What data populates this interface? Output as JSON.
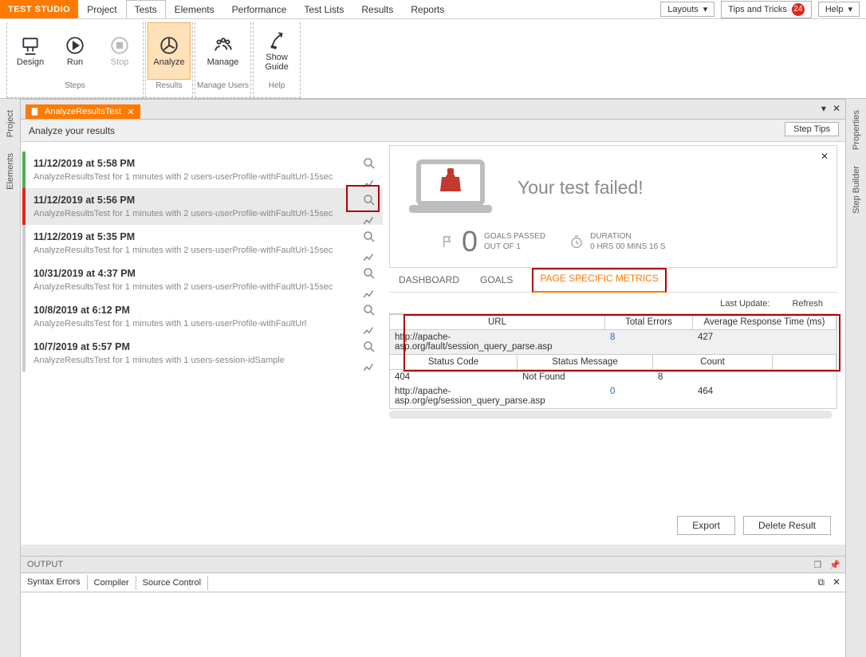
{
  "brand": "TEST STUDIO",
  "menu": [
    "Project",
    "Tests",
    "Elements",
    "Performance",
    "Test Lists",
    "Results",
    "Reports"
  ],
  "menu_active": 1,
  "top_right": {
    "layouts": "Layouts",
    "tips": "Tips and Tricks",
    "tips_badge": "24",
    "help": "Help"
  },
  "ribbon": {
    "steps": {
      "label": "Steps",
      "items": [
        {
          "t": "Design"
        },
        {
          "t": "Run"
        },
        {
          "t": "Stop",
          "disabled": true
        }
      ]
    },
    "results": {
      "label": "Results",
      "items": [
        {
          "t": "Analyze",
          "active": true
        }
      ]
    },
    "users": {
      "label": "Manage Users",
      "items": [
        {
          "t": "Manage"
        }
      ]
    },
    "help": {
      "label": "Help",
      "items": [
        {
          "t": "Show\nGuide"
        }
      ]
    }
  },
  "left_tabs": [
    "Project",
    "Elements"
  ],
  "right_tabs": [
    "Properties",
    "Step Builder"
  ],
  "file_tab": "AnalyzeResultsTest",
  "subtitle": "Analyze your results",
  "step_tips": "Step Tips",
  "runs": [
    {
      "t": "11/12/2019 at 5:58 PM",
      "d": "AnalyzeResultsTest for 1 minutes with 2 users-userProfile-withFaultUrl-15sec",
      "state": "pass"
    },
    {
      "t": "11/12/2019 at 5:56 PM",
      "d": "AnalyzeResultsTest for 1 minutes with 2 users-userProfile-withFaultUrl-15sec",
      "state": "fail",
      "selected": true,
      "hl": true
    },
    {
      "t": "11/12/2019 at 5:35 PM",
      "d": "AnalyzeResultsTest for 1 minutes with 2 users-userProfile-withFaultUrl-15sec",
      "state": "neutral"
    },
    {
      "t": "10/31/2019 at 4:37 PM",
      "d": "AnalyzeResultsTest for 1 minutes with 2 users-userProfile-withFaultUrl-15sec",
      "state": "neutral"
    },
    {
      "t": "10/8/2019 at 6:12 PM",
      "d": "AnalyzeResultsTest for 1 minutes with 1 users-userProfile-withFaultUrl",
      "state": "neutral"
    },
    {
      "t": "10/7/2019 at 5:57 PM",
      "d": "AnalyzeResultsTest for 1 minutes with 1 users-session-idSample",
      "state": "neutral"
    }
  ],
  "status": {
    "title": "Your test failed!",
    "goals_num": "0",
    "goals_l1": "GOALS PASSED",
    "goals_l2": "OUT OF 1",
    "dur_l": "DURATION",
    "dur_v": "0 HRS  00 MINS  16 S"
  },
  "tabs2": [
    "DASHBOARD",
    "GOALS",
    "PAGE SPECIFIC METRICS"
  ],
  "tabs2_active": 2,
  "meta": {
    "last_update": "Last Update:",
    "refresh": "Refresh"
  },
  "table": {
    "headers": [
      "URL",
      "Total Errors",
      "Average Response Time (ms)"
    ],
    "rows": [
      {
        "url": "http://apache-asp.org/fault/session_query_parse.asp",
        "errors": "8",
        "avg": "427"
      },
      {
        "url": "http://apache-asp.org/eg/session_query_parse.asp",
        "errors": "0",
        "avg": "464"
      }
    ],
    "sub_headers": [
      "Status Code",
      "Status Message",
      "Count",
      ""
    ],
    "sub_row": [
      "404",
      "Not Found",
      "8",
      ""
    ]
  },
  "buttons": {
    "export": "Export",
    "delete": "Delete Result"
  },
  "output": {
    "title": "OUTPUT",
    "tabs": [
      "Syntax Errors",
      "Compiler",
      "Source Control"
    ]
  }
}
